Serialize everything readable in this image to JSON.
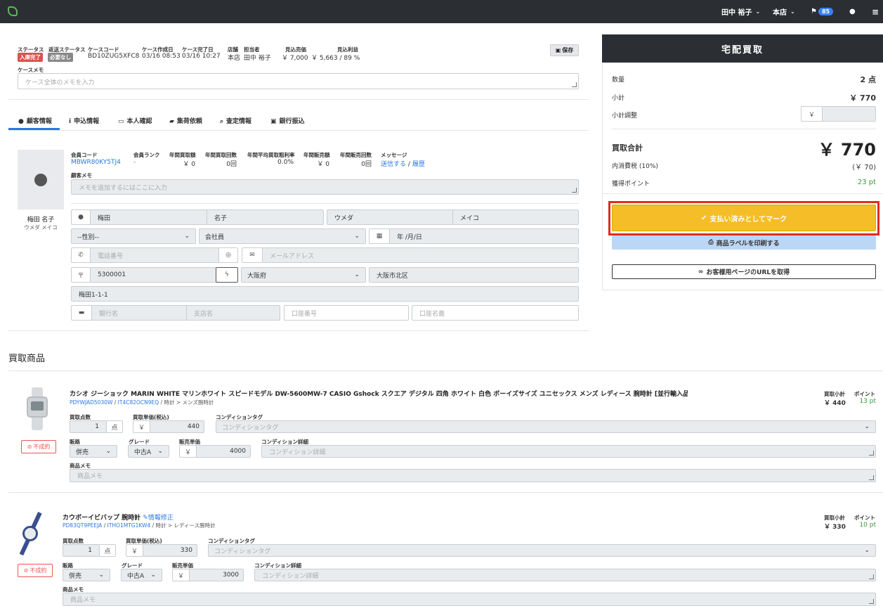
{
  "topbar": {
    "user": "田中 裕子",
    "store": "本店",
    "badge": "85"
  },
  "case": {
    "labels": {
      "status": "ステータス",
      "return_status": "返送ステータス",
      "case_code": "ケースコード",
      "created": "ケース作成日",
      "completed": "ケース完了日",
      "store": "店舗",
      "staff": "担当者",
      "est_sales": "見込売価",
      "est_profit": "見込利益",
      "memo": "ケースメモ"
    },
    "status_chip": "入庫完了",
    "return_chip": "必要なし",
    "case_code": "BD10ZUG5XFC8",
    "created": "03/16 08:53",
    "completed": "03/16 10:27",
    "store": "本店",
    "staff": "田中 裕子",
    "est_sales": "￥ 7,000",
    "est_profit": "￥ 5,663 / 89 %",
    "save_label": "保存",
    "memo_placeholder": "ケース全体のメモを入力"
  },
  "tabs": [
    "顧客情報",
    "申込情報",
    "本人確認",
    "集荷依頼",
    "査定情報",
    "銀行振込"
  ],
  "customer": {
    "name": "梅田 名子",
    "kana": "ウメダ メイコ",
    "labels": {
      "code": "会員コード",
      "rank": "会員ランク",
      "annual_buy": "年間買取額",
      "annual_buy_count": "年間買取回数",
      "avg_margin": "年間平均買取粗利率",
      "annual_sales": "年間販売額",
      "annual_sales_count": "年間販売回数",
      "message": "メッセージ",
      "memo": "顧客メモ"
    },
    "code": "MBWR80KY5TJ4",
    "rank": "-",
    "annual_buy": "￥ 0",
    "annual_buy_count": "0回",
    "avg_margin": "0.0%",
    "annual_sales": "￥ 0",
    "annual_sales_count": "0回",
    "msg_send": "送信する",
    "msg_sep": "/",
    "msg_history": "履歴",
    "memo_placeholder": "メモを追加するにはここに入力",
    "last_name": "梅田",
    "first_name": "名子",
    "last_kana": "ウメダ",
    "first_kana": "メイコ",
    "gender": "--性別--",
    "occupation": "会社員",
    "birthday": "年 /月/日",
    "phone_placeholder": "電話番号",
    "email_placeholder": "メールアドレス",
    "postal_prefix": "〒",
    "postal": "5300001",
    "prefecture": "大阪府",
    "city": "大阪市北区",
    "address": "梅田1-1-1",
    "bank_placeholder": "銀行名",
    "branch_placeholder": "支店名",
    "account_no_placeholder": "口座番号",
    "account_name_placeholder": "口座名義"
  },
  "summary": {
    "title": "宅配買取",
    "qty_label": "数量",
    "qty": "2 点",
    "subtotal_label": "小計",
    "subtotal": "￥ 770",
    "adjust_label": "小計調整",
    "yen": "￥",
    "total_label": "買取合計",
    "total": "￥ 770",
    "tax_label": "内消費税 (10%)",
    "tax": "(￥ 70)",
    "points_label": "獲得ポイント",
    "points": "23 pt",
    "mark_paid": "支払い済みとしてマーク",
    "print_label": "商品ラベルを印刷する",
    "get_url": "お客様用ページのURLを取得"
  },
  "products_heading": "買取商品",
  "product_labels": {
    "qty": "買取点数",
    "unit_price": "買取単価(税込)",
    "condition_tag": "コンディションタグ",
    "channel": "販路",
    "grade": "グレード",
    "sale_price": "販売単価",
    "condition_detail": "コンディション詳細",
    "memo": "商品メモ",
    "subtotal": "買取小計",
    "point": "ポイント",
    "unit": "点",
    "yen": "￥",
    "edit": "情報修正",
    "not_contracted": "不成約",
    "tag_placeholder": "コンディションタグ",
    "detail_placeholder": "コンディション詳細",
    "memo_placeholder": "商品メモ"
  },
  "products": [
    {
      "title": "カシオ ジーショック MARIN WHITE マリンホワイト スピードモデル DW-5600MW-7 CASIO Gshock スクエア デジタル 四角 ホワイト 白色 ボーイズサイズ ユニセックス メンズ レディース 腕時計 [並行輸入品]",
      "code1": "PDYWJAD5030W",
      "code2": "IT4C82OCN9EQ",
      "category": "時計 > メンズ腕時計",
      "qty": "1",
      "unit_price": "440",
      "channel": "併売",
      "grade": "中古A",
      "sale_price": "4000",
      "subtotal": "￥ 440",
      "point": "13 pt"
    },
    {
      "title": "カウボーイビバップ 腕時計",
      "code1": "PD83QT9PEEJA",
      "code2": "ITHO1MTG1KW4",
      "category": "時計 > レディース腕時計",
      "qty": "1",
      "unit_price": "330",
      "channel": "併売",
      "grade": "中古A",
      "sale_price": "3000",
      "subtotal": "￥ 330",
      "point": "10 pt"
    }
  ]
}
